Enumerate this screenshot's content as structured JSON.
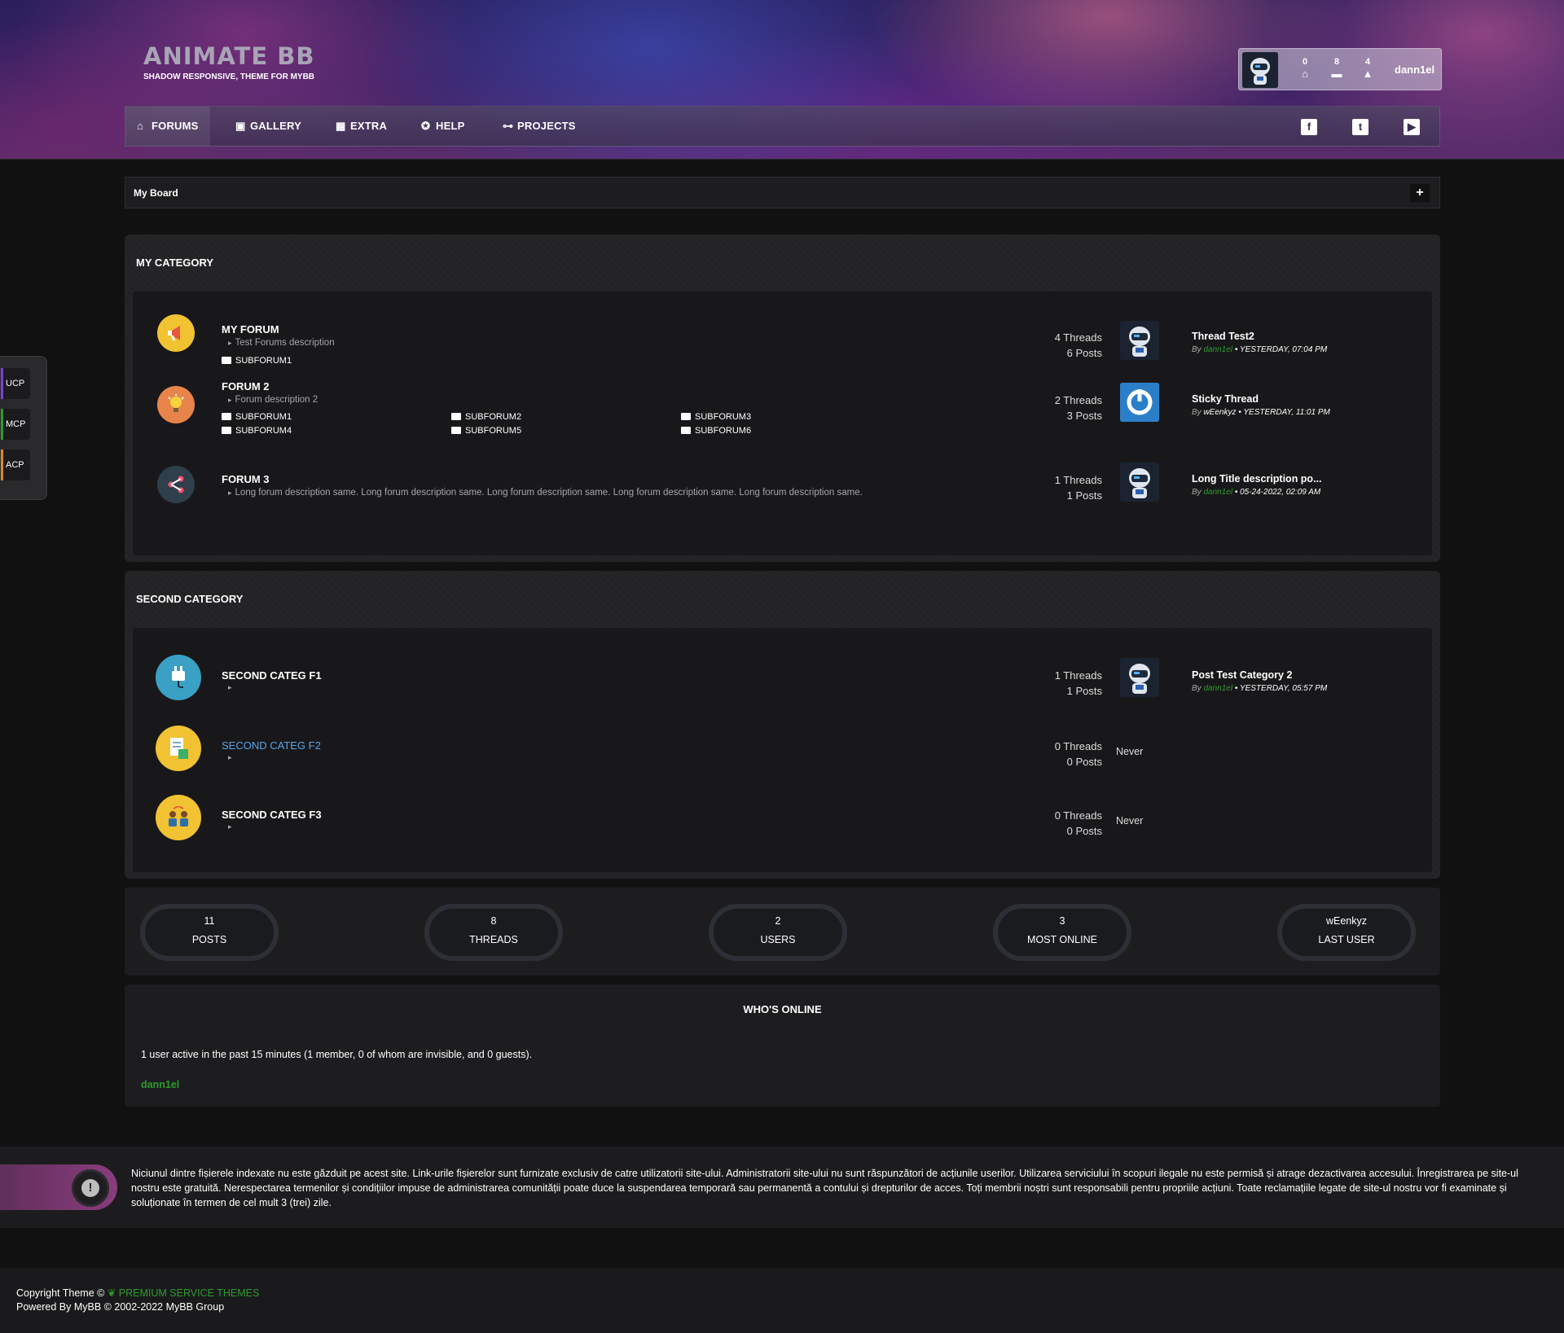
{
  "header": {
    "logo_title": "ANIMATE BB",
    "logo_subtitle": "SHADOW RESPONSIVE, THEME FOR MYBB",
    "user_panel": {
      "inbox_count": "0",
      "calendar_count": "8",
      "notifications_count": "4",
      "username": "dann1el"
    }
  },
  "nav": {
    "items": [
      {
        "label": "FORUMS",
        "icon": "home-icon"
      },
      {
        "label": "GALLERY",
        "icon": "image-icon"
      },
      {
        "label": "EXTRA",
        "icon": "grid-icon"
      },
      {
        "label": "HELP",
        "icon": "help-icon"
      },
      {
        "label": "PROJECTS",
        "icon": "sitemap-icon"
      }
    ],
    "social": [
      "facebook-icon",
      "twitter-icon",
      "youtube-icon"
    ]
  },
  "breadcrumb": {
    "label": "My Board",
    "toggle": "+"
  },
  "side_tabs": [
    {
      "label": "UCP",
      "color": "#7a3fd6"
    },
    {
      "label": "MCP",
      "color": "#2e9b2e"
    },
    {
      "label": "ACP",
      "color": "#d98a1e"
    }
  ],
  "categories": [
    {
      "title": "MY CATEGORY",
      "forums": [
        {
          "name": "MY FORUM",
          "description": "Test Forums description",
          "subforums": [
            "SUBFORUM1"
          ],
          "threads": "4 Threads",
          "posts": "6 Posts",
          "last_title": "Thread Test2",
          "last_by": "By",
          "last_user": "dann1el",
          "last_date": "• YESTERDAY, 07:04 PM"
        },
        {
          "name": "FORUM 2",
          "description": "Forum description 2",
          "subforums": [
            "SUBFORUM1",
            "SUBFORUM2",
            "SUBFORUM3",
            "SUBFORUM4",
            "SUBFORUM5",
            "SUBFORUM6"
          ],
          "threads": "2 Threads",
          "posts": "3 Posts",
          "last_title": "Sticky Thread",
          "last_by": "By",
          "last_user": "wEenkyz",
          "last_date": "• YESTERDAY, 11:01 PM"
        },
        {
          "name": "FORUM 3",
          "description": "Long forum description same. Long forum description same. Long forum description same. Long forum description same. Long forum description same.",
          "threads": "1 Threads",
          "posts": "1 Posts",
          "last_title": "Long Title description po...",
          "last_by": "By",
          "last_user": "dann1el",
          "last_date": "• 05-24-2022, 02:09 AM"
        }
      ]
    },
    {
      "title": "SECOND CATEGORY",
      "forums": [
        {
          "name": "SECOND CATEG F1",
          "threads": "1 Threads",
          "posts": "1 Posts",
          "last_title": "Post Test Category 2",
          "last_by": "By",
          "last_user": "dann1el",
          "last_date": "• YESTERDAY, 05:57 PM"
        },
        {
          "name": "SECOND CATEG F2",
          "threads": "0 Threads",
          "posts": "0 Posts",
          "last": "Never"
        },
        {
          "name": "SECOND CATEG F3",
          "threads": "0 Threads",
          "posts": "0 Posts",
          "last": "Never"
        }
      ]
    }
  ],
  "stats": [
    {
      "value": "11",
      "label": "POSTS"
    },
    {
      "value": "8",
      "label": "THREADS"
    },
    {
      "value": "2",
      "label": "USERS"
    },
    {
      "value": "3",
      "label": "MOST ONLINE"
    },
    {
      "value": "wEenkyz",
      "label": "LAST USER"
    }
  ],
  "online": {
    "title": "WHO'S ONLINE",
    "summary": "1 user active in the past 15 minutes (1 member, 0 of whom are invisible, and 0 guests).",
    "user": "dann1el"
  },
  "disclaimer": {
    "icon": "exclamation-icon",
    "text": "Niciunul dintre fișierele indexate nu este găzduit pe acest site. Link-urile fișierelor sunt furnizate exclusiv de catre utilizatorii site-ului. Administratorii site-ului nu sunt răspunzători de acțiunile userilor. Utilizarea serviciului în scopuri ilegale nu este permisă și atrage dezactivarea accesului. Înregistrarea pe site-ul nostru este gratuită. Nerespectarea termenilor și condițiilor impuse de administrarea comunității poate duce la suspendarea temporară sau permanentă a contului și drepturilor de acces. Toți membrii noștri sunt responsabili pentru propriile acțiuni. Toate reclamațiile legate de site-ul nostru vor fi examinate și soluționate în termen de cel mult 3 (trei) zile."
  },
  "footer": {
    "copyright_prefix": "Copyright Theme ©",
    "theme_link": "PREMIUM SERVICE THEMES",
    "powered": "Powered By MyBB © 2002-2022 MyBB Group"
  }
}
